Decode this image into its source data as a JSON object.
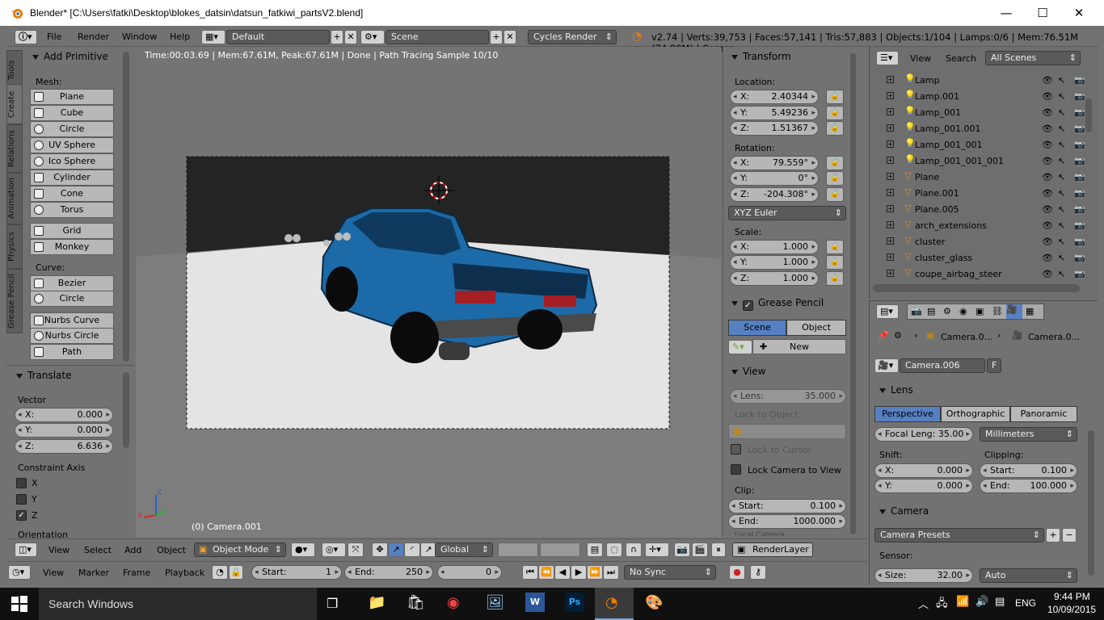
{
  "window": {
    "title": "Blender* [C:\\Users\\fatki\\Desktop\\blokes_datsin\\datsun_fatkiwi_partsV2.blend]",
    "minimize": "—",
    "maximize": "☐",
    "close": "✕"
  },
  "infobar": {
    "menus": [
      "File",
      "Render",
      "Window",
      "Help"
    ],
    "layout": "Default",
    "scene": "Scene",
    "engine": "Cycles Render",
    "stats": "v2.74 | Verts:39,753 | Faces:57,141 | Tris:57,883 | Objects:1/104 | Lamps:0/6 | Mem:76.51M (74.80M) | Camer"
  },
  "tool_tabs": [
    "Tools",
    "Create",
    "Relations",
    "Animation",
    "Physics",
    "Grease Pencil"
  ],
  "add_primitive": {
    "title": "Add Primitive",
    "mesh_label": "Mesh:",
    "mesh": [
      "Plane",
      "Cube",
      "Circle",
      "UV Sphere",
      "Ico Sphere",
      "Cylinder",
      "Cone",
      "Torus"
    ],
    "mesh2": [
      "Grid",
      "Monkey"
    ],
    "curve_label": "Curve:",
    "curve": [
      "Bezier",
      "Circle"
    ],
    "curve2": [
      "Nurbs Curve",
      "Nurbs Circle",
      "Path"
    ]
  },
  "translate": {
    "title": "Translate",
    "vector_label": "Vector",
    "x": {
      "k": "X:",
      "v": "0.000"
    },
    "y": {
      "k": "Y:",
      "v": "0.000"
    },
    "z": {
      "k": "Z:",
      "v": "6.636"
    },
    "constraint_label": "Constraint Axis",
    "axes": [
      "X",
      "Y",
      "Z"
    ],
    "orientation_label": "Orientation"
  },
  "viewport": {
    "render_status": "Time:00:03.69 | Mem:67.61M, Peak:67.61M | Done | Path Tracing Sample 10/10",
    "object_label": "(0) Camera.001",
    "axis_x": "x",
    "axis_z": "z"
  },
  "viewport_header": {
    "menus": [
      "View",
      "Select",
      "Add",
      "Object"
    ],
    "mode": "Object Mode",
    "orientation": "Global",
    "render_layer": "RenderLayer"
  },
  "timeline": {
    "menus": [
      "View",
      "Marker",
      "Frame",
      "Playback"
    ],
    "start_label": "Start:",
    "start": "1",
    "end_label": "End:",
    "end": "250",
    "frame": "0",
    "sync": "No Sync"
  },
  "transform": {
    "title": "Transform",
    "location_label": "Location:",
    "loc": [
      {
        "k": "X:",
        "v": "2.40344"
      },
      {
        "k": "Y:",
        "v": "5.49236"
      },
      {
        "k": "Z:",
        "v": "1.51367"
      }
    ],
    "rotation_label": "Rotation:",
    "rot": [
      {
        "k": "X:",
        "v": "79.559°"
      },
      {
        "k": "Y:",
        "v": "0°"
      },
      {
        "k": "Z:",
        "v": "-204.308°"
      }
    ],
    "rotation_mode": "XYZ Euler",
    "scale_label": "Scale:",
    "scale": [
      {
        "k": "X:",
        "v": "1.000"
      },
      {
        "k": "Y:",
        "v": "1.000"
      },
      {
        "k": "Z:",
        "v": "1.000"
      }
    ]
  },
  "grease_pencil": {
    "title": "Grease Pencil",
    "scene": "Scene",
    "object": "Object",
    "new": "New"
  },
  "view_panel": {
    "title": "View",
    "lens": {
      "k": "Lens:",
      "v": "35.000"
    },
    "lock_object": "Lock to Object:",
    "lock_cursor": "Lock to Cursor",
    "lock_camera": "Lock Camera to View",
    "clip_label": "Clip:",
    "clip_start": {
      "k": "Start:",
      "v": "0.100"
    },
    "clip_end": {
      "k": "End:",
      "v": "1000.000"
    },
    "cut": "Local Camera"
  },
  "outliner": {
    "menus": [
      "View",
      "Search"
    ],
    "filter": "All Scenes",
    "items": [
      "Lamp",
      "Lamp.001",
      "Lamp_001",
      "Lamp_001.001",
      "Lamp_001_001",
      "Lamp_001_001_001",
      "Plane",
      "Plane.001",
      "Plane.005",
      "arch_extensions",
      "cluster",
      "cluster_glass",
      "coupe_airbag_steer"
    ],
    "item_types": [
      "lamp",
      "lamp",
      "lamp",
      "lamp",
      "lamp",
      "lamp",
      "mesh",
      "mesh",
      "mesh",
      "mesh",
      "mesh",
      "mesh",
      "mesh"
    ]
  },
  "properties": {
    "breadcrumb1": "Camera.0...",
    "breadcrumb2": "Camera.0...",
    "datablock": "Camera.006",
    "fake": "F",
    "lens_title": "Lens",
    "lens_tabs": [
      "Perspective",
      "Orthographic",
      "Panoramic"
    ],
    "focal": "Focal Leng: 35.00",
    "units": "Millimeters",
    "shift_label": "Shift:",
    "shift_x": {
      "k": "X:",
      "v": "0.000"
    },
    "shift_y": {
      "k": "Y:",
      "v": "0.000"
    },
    "clipping_label": "Clipping:",
    "clip_start": {
      "k": "Start:",
      "v": "0.100"
    },
    "clip_end": {
      "k": "End:",
      "v": "100.000"
    },
    "camera_title": "Camera",
    "presets": "Camera Presets",
    "sensor_label": "Sensor:",
    "size": {
      "k": "Size:",
      "v": "32.00"
    },
    "fit": "Auto"
  },
  "taskbar": {
    "search": "Search Windows",
    "lang": "ENG",
    "time": "9:44 PM",
    "date": "10/09/2015"
  },
  "colors": {
    "accent_blue": "#5680c2",
    "car_blue": "#1c6aa8",
    "panel": "#727272",
    "viewport_dark": "#2a2a2a"
  }
}
